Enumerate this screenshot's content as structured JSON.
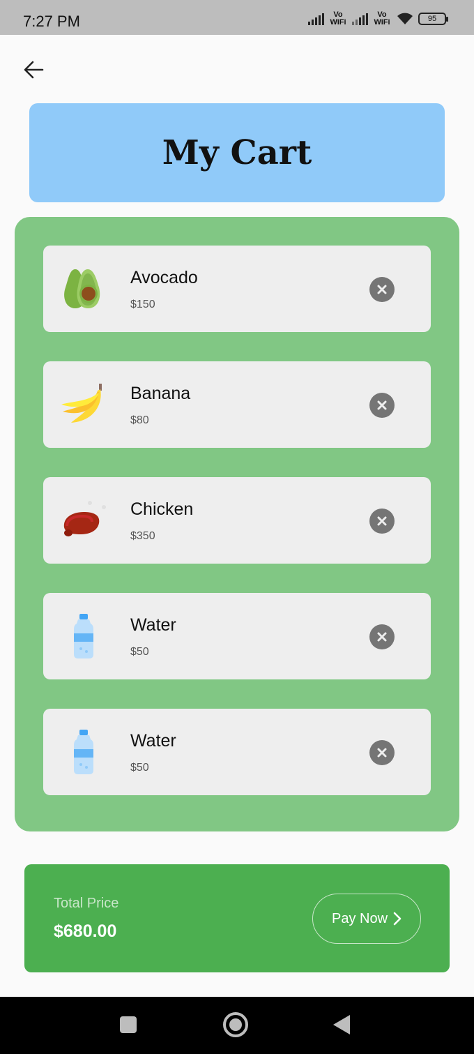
{
  "status_bar": {
    "time": "7:27 PM",
    "network_label_1": "Vo WiFi",
    "network_label_2": "Vo WiFi",
    "battery": "95"
  },
  "header": {
    "title": "My Cart"
  },
  "cart": {
    "items": [
      {
        "name": "Avocado",
        "price": "$150",
        "icon": "avocado-icon"
      },
      {
        "name": "Banana",
        "price": "$80",
        "icon": "banana-icon"
      },
      {
        "name": "Chicken",
        "price": "$350",
        "icon": "chicken-icon"
      },
      {
        "name": "Water",
        "price": "$50",
        "icon": "water-bottle-icon"
      },
      {
        "name": "Water",
        "price": "$50",
        "icon": "water-bottle-icon"
      }
    ]
  },
  "footer": {
    "total_label": "Total Price",
    "total_value": "$680.00",
    "pay_label": "Pay Now"
  },
  "colors": {
    "header_bg": "#90caf9",
    "list_bg": "#81c784",
    "total_bg": "#4caf50",
    "card_bg": "#eeeeee"
  }
}
